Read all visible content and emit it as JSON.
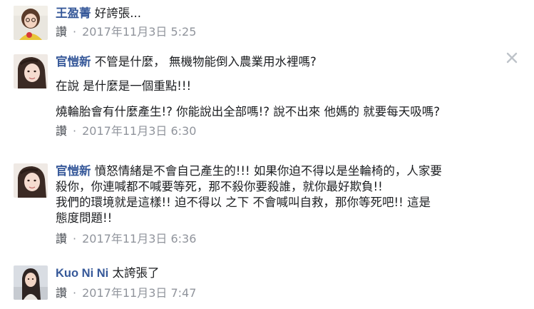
{
  "comments": [
    {
      "author": "王盈菁",
      "lines": [
        "好誇張..."
      ],
      "like_label": "讚",
      "separator": "·",
      "timestamp": "2017年11月3日 5:25"
    },
    {
      "author": "官愷新",
      "lines": [
        "不管是什麼，  無機物能倒入農業用水裡嗎?",
        "在說 是什麼是一個重點!!!",
        "燒輪胎會有什麼產生!? 你能說出全部嗎!? 說不出來 他媽的 就要每天吸嗎?"
      ],
      "like_label": "讚",
      "separator": "·",
      "timestamp": "2017年11月3日 6:30"
    },
    {
      "author": "官愷新",
      "lines": [
        "憤怒情緒是不會自己產生的!!! 如果你迫不得以是坐輪椅的，人家要",
        "殺你，你連喊都不喊要等死，那不殺你要殺誰，就你最好欺負!!",
        "我們的環境就是這樣!! 迫不得以 之下 不會喊叫自救，那你等死吧!! 這是",
        "態度問題!!"
      ],
      "like_label": "讚",
      "separator": "·",
      "timestamp": "2017年11月3日 6:36"
    },
    {
      "author": "Kuo Ni Ni",
      "lines": [
        "太誇張了"
      ],
      "like_label": "讚",
      "separator": "·",
      "timestamp": "2017年11月3日 7:47"
    }
  ],
  "close_icon": "close-icon",
  "colors": {
    "author": "#365899",
    "meta": "#90949c",
    "text": "#1c1e21"
  }
}
